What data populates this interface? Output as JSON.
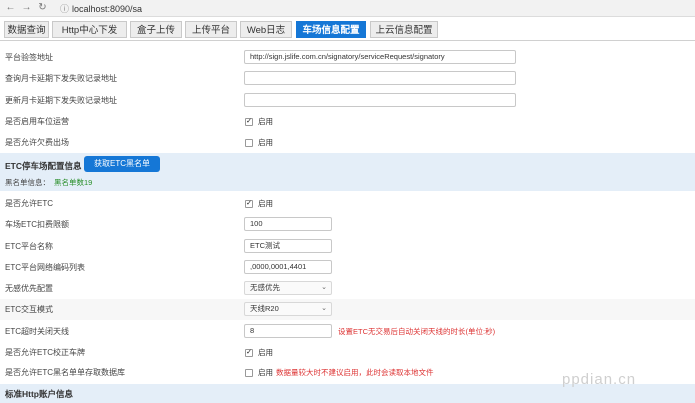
{
  "browser": {
    "url": "localhost:8090/sa"
  },
  "tabs": [
    {
      "label": "数据查询"
    },
    {
      "label": "Http中心下发"
    },
    {
      "label": "盒子上传"
    },
    {
      "label": "上传平台"
    },
    {
      "label": "Web日志"
    },
    {
      "label": "车场信息配置"
    },
    {
      "label": "上云信息配置"
    }
  ],
  "form_top": {
    "platform_sign_url": {
      "label": "平台验签地址",
      "value": "http://sign.jslife.com.cn/signatory/serviceRequest/signatory"
    },
    "query_monthcard_fail_url": {
      "label": "查询月卡延期下发失败记录地址",
      "value": ""
    },
    "update_monthcard_fail_url": {
      "label": "更新月卡延期下发失败记录地址",
      "value": ""
    },
    "enable_space_ops": {
      "label": "是否启用车位运营",
      "checked": true,
      "check_label": "启用"
    },
    "allow_owe_exit": {
      "label": "是否允许欠费出场",
      "checked": false,
      "check_label": "启用"
    }
  },
  "etc_section": {
    "title": "ETC停车场配置信息",
    "button": "获取ETC黑名单",
    "blacklist_label": "黑名单信息：",
    "blacklist_value": "黑名单数19"
  },
  "etc_form": {
    "allow_etc": {
      "label": "是否允许ETC",
      "checked": true,
      "check_label": "启用"
    },
    "deduct_limit": {
      "label": "车场ETC扣费限额",
      "value": "100"
    },
    "platform_name": {
      "label": "ETC平台名称",
      "value": "ETC测试"
    },
    "network_codes": {
      "label": "ETC平台网络编码列表",
      "value": ",0000,0001,4401"
    },
    "no_sense_priority": {
      "label": "无感优先配置",
      "value": "无感优先"
    },
    "interaction_mode": {
      "label": "ETC交互模式",
      "value": "天线R20"
    },
    "timeout_close": {
      "label": "ETC超时关闭天线",
      "value": "8",
      "note": "设置ETC无交易后自动关闭天线的时长(单位:秒)"
    },
    "allow_correct_plate": {
      "label": "是否允许ETC校正车牌",
      "checked": true,
      "check_label": "启用"
    },
    "blacklist_db": {
      "label": "是否允许ETC黑名单单存取数据库",
      "checked": false,
      "check_label": "启用",
      "note": "数据量较大时不建议启用，此时会读取本地文件"
    }
  },
  "http_section": {
    "title": "标准Http账户信息"
  },
  "watermark": "ppdian.cn",
  "colors": {
    "accent": "#1577d6",
    "section_bg": "#e4eef8",
    "note": "#d33333",
    "success": "#2a8f2a"
  }
}
